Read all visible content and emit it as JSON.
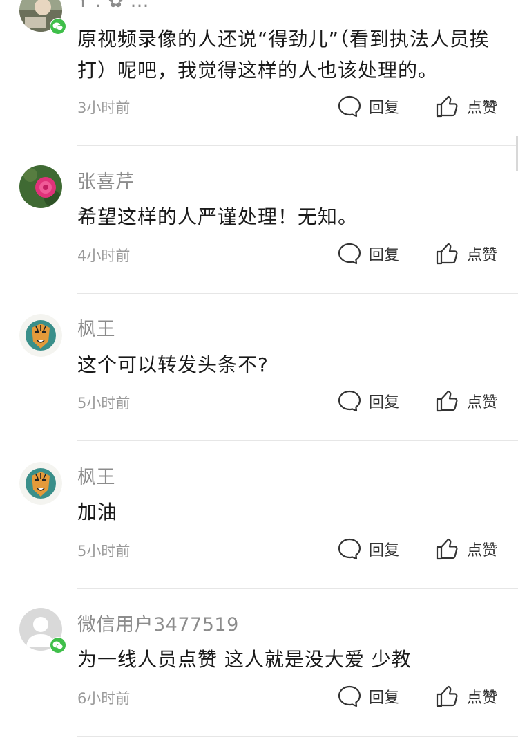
{
  "comments": [
    {
      "username": "Y . ✿  …",
      "text": "原视频录像的人还说“得劲儿”（看到执法人员挨打）呢吧，我觉得这样的人也该处理的。",
      "time": "3小时前",
      "avatar": "photo-avatar",
      "wechat_badge": true
    },
    {
      "username": "张喜芹",
      "text": "希望这样的人严谨处理！无知。",
      "time": "4小时前",
      "avatar": "pink-flower-avatar",
      "wechat_badge": false
    },
    {
      "username": "枫王",
      "text": "这个可以转发头条不?",
      "time": "5小时前",
      "avatar": "tiger-avatar",
      "wechat_badge": false
    },
    {
      "username": "枫王",
      "text": "加油",
      "time": "5小时前",
      "avatar": "tiger-avatar",
      "wechat_badge": false
    },
    {
      "username": "微信用户3477519",
      "text": "为一线人员点赞 这人就是没大爱 少教",
      "time": "6小时前",
      "avatar": "default-user-avatar",
      "wechat_badge": true
    }
  ],
  "actions": {
    "reply_label": "回复",
    "like_label": "点赞",
    "reply_icon": "comment-bubble-icon",
    "like_icon": "thumbs-up-icon"
  },
  "colors": {
    "username": "#8c8c8c",
    "text": "#1a1a1a",
    "time": "#9a9a9a",
    "icon": "#333333",
    "divider": "#e6e6e6",
    "wechat_green": "#3fbf4a"
  }
}
